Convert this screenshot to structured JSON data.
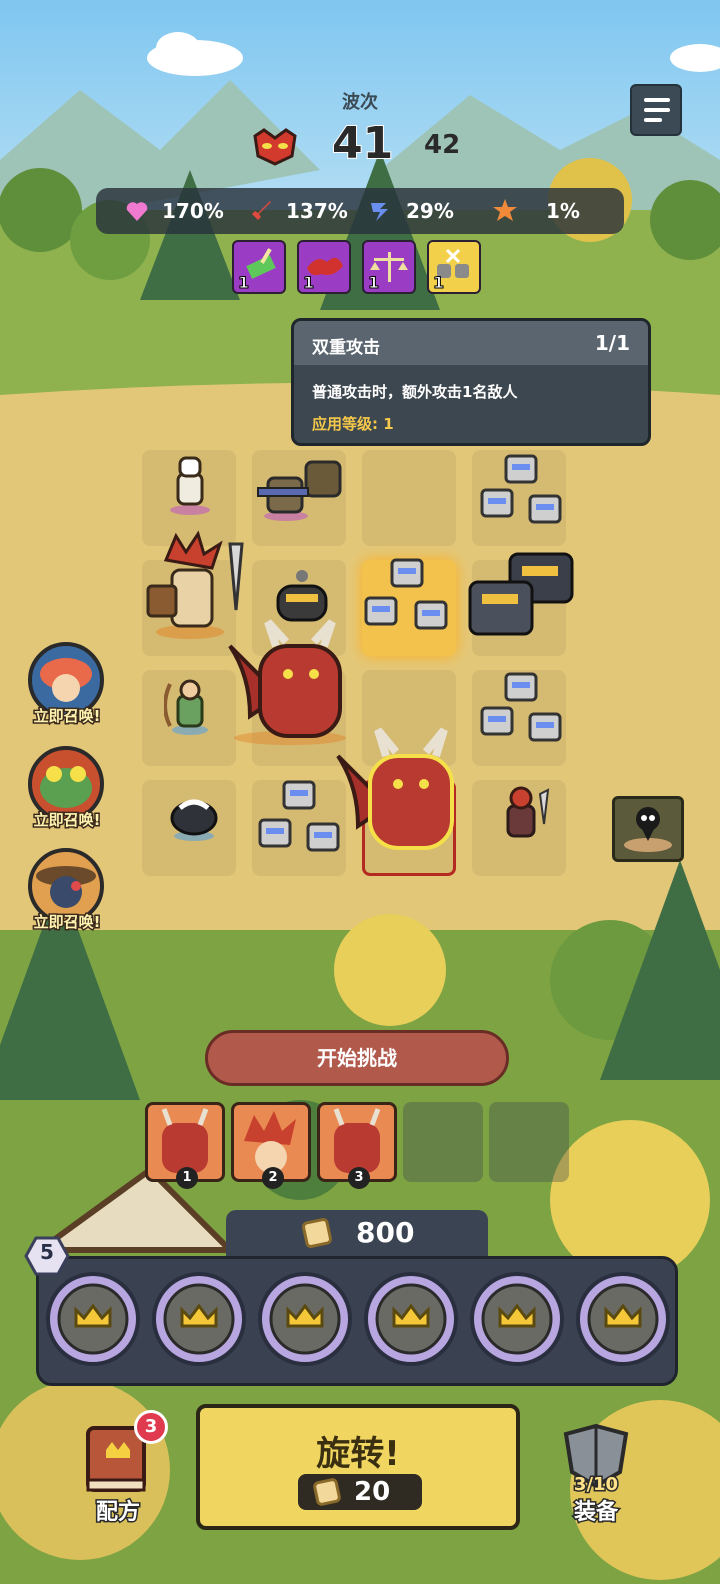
{
  "header": {
    "wave_label": "波次",
    "wave_current": "41",
    "wave_next": "42"
  },
  "stats": [
    {
      "icon": "heart-icon",
      "value": "170%",
      "color": "#f07ad0"
    },
    {
      "icon": "sword-icon",
      "value": "137%",
      "color": "#e04a3e"
    },
    {
      "icon": "speed-icon",
      "value": "29%",
      "color": "#6a8ef0"
    },
    {
      "icon": "crit-icon",
      "value": "1%",
      "color": "#f08a3a"
    }
  ],
  "buffs": [
    {
      "name": "money-buff-icon",
      "level": "1",
      "color": "#9b3cc4"
    },
    {
      "name": "blood-buff-icon",
      "level": "1",
      "color": "#9b3cc4"
    },
    {
      "name": "scale-buff-icon",
      "level": "1",
      "color": "#9b3cc4"
    },
    {
      "name": "double-attack-buff-icon",
      "level": "1",
      "color": "#f2d04a"
    }
  ],
  "tooltip": {
    "title": "双重攻击",
    "count": "1/1",
    "description": "普通攻击时，额外攻击1名敌人",
    "applied_level": "应用等级: 1"
  },
  "summons": [
    {
      "name": "summon-mushroom-hero",
      "label": "立即召唤!"
    },
    {
      "name": "summon-frog-hero",
      "label": "立即召唤!"
    },
    {
      "name": "summon-ninja-hero",
      "label": "立即召唤!"
    }
  ],
  "start_button": "开始挑战",
  "recipe_slots": [
    {
      "number": "1",
      "unit": "red-dragon"
    },
    {
      "number": "2",
      "unit": "red-hair-warrior"
    },
    {
      "number": "3",
      "unit": "red-dragon"
    }
  ],
  "gold": "800",
  "slot_level": "5",
  "spin": {
    "label": "旋转!",
    "cost": "20"
  },
  "recipe_book": {
    "label": "配方",
    "badge": "3"
  },
  "equipment": {
    "label": "装备",
    "count": "3/10"
  },
  "colors": {
    "sky": "#a8d8f0",
    "ground": "#e3c779",
    "grass": "#8fb24e",
    "spin_yellow": "#f0d560",
    "purple_card": "#9b3cc4"
  }
}
